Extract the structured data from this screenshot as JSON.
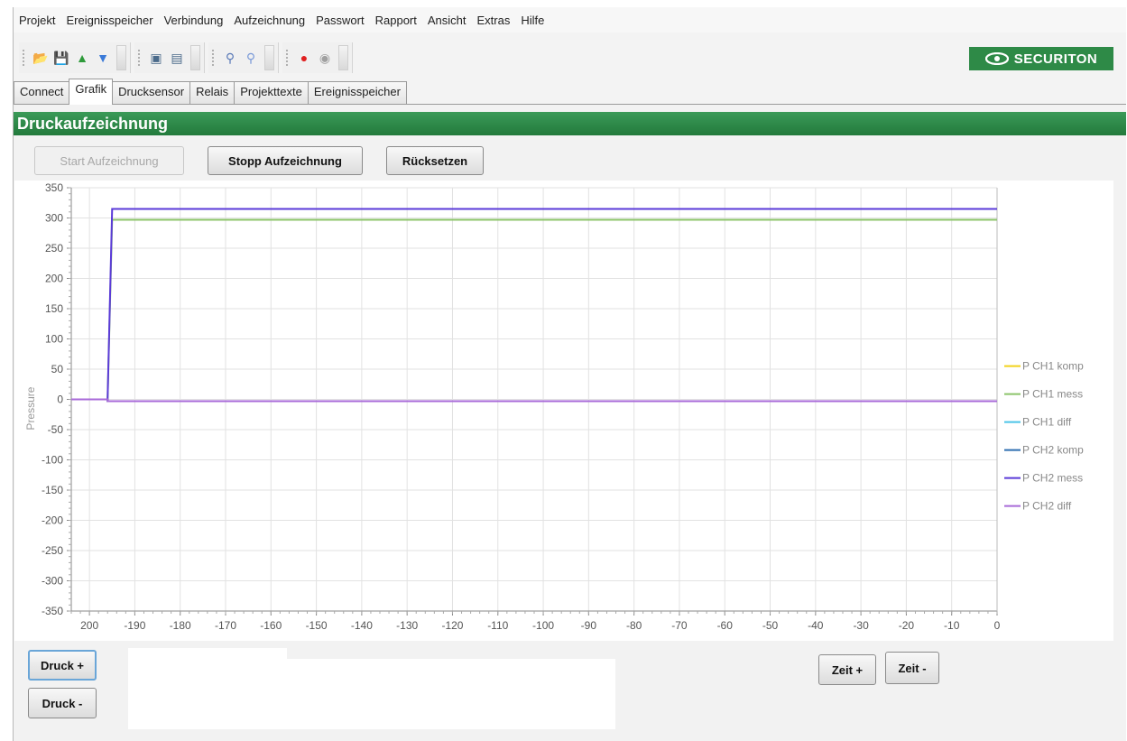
{
  "menu": [
    "Projekt",
    "Ereignisspeicher",
    "Verbindung",
    "Aufzeichnung",
    "Passwort",
    "Rapport",
    "Ansicht",
    "Extras",
    "Hilfe"
  ],
  "brand": {
    "name": "SECURITON",
    "color": "#2e8a47"
  },
  "toolbar": {
    "groups": [
      [
        {
          "icon": "folder-open-icon",
          "glyph": "📂",
          "color": "#d9a21b"
        },
        {
          "icon": "save-icon",
          "glyph": "💾",
          "color": "#7a4a1a"
        },
        {
          "icon": "upload-arrow-icon",
          "glyph": "▲",
          "color": "#2e9a3a"
        },
        {
          "icon": "download-arrow-icon",
          "glyph": "▼",
          "color": "#3a7ad8"
        }
      ],
      [
        {
          "icon": "device-icon",
          "glyph": "▣",
          "color": "#4a6a8a"
        },
        {
          "icon": "device-config-icon",
          "glyph": "▤",
          "color": "#4a6a8a"
        }
      ],
      [
        {
          "icon": "connect-plug-icon",
          "glyph": "⚲",
          "color": "#5a7ab8"
        },
        {
          "icon": "disconnect-plug-icon",
          "glyph": "⚲",
          "color": "#7a9ad8"
        }
      ],
      [
        {
          "icon": "record-icon",
          "glyph": "●",
          "color": "#e02020"
        },
        {
          "icon": "stop-record-icon",
          "glyph": "◉",
          "color": "#a0a0a0"
        }
      ]
    ]
  },
  "tabs": [
    {
      "label": "Connect",
      "active": false
    },
    {
      "label": "Grafik",
      "active": true
    },
    {
      "label": "Drucksensor",
      "active": false
    },
    {
      "label": "Relais",
      "active": false
    },
    {
      "label": "Projekttexte",
      "active": false
    },
    {
      "label": "Ereignisspeicher",
      "active": false
    }
  ],
  "panel": {
    "title": "Druckaufzeichnung",
    "start_label": "Start Aufzeichnung",
    "stop_label": "Stopp Aufzeichnung",
    "reset_label": "Rücksetzen",
    "druck_plus": "Druck +",
    "druck_minus": "Druck -",
    "zeit_plus": "Zeit +",
    "zeit_minus": "Zeit -"
  },
  "chart_data": {
    "type": "line",
    "title": "",
    "xlabel": "",
    "ylabel": "Pressure",
    "xlim": [
      -204,
      0
    ],
    "ylim": [
      -350,
      350
    ],
    "xticks": [
      -200,
      -190,
      -180,
      -170,
      -160,
      -150,
      -140,
      -130,
      -120,
      -110,
      -100,
      -90,
      -80,
      -70,
      -60,
      -50,
      -40,
      -30,
      -20,
      -10,
      0
    ],
    "xtick_labels": [
      "200",
      "-190",
      "-180",
      "-170",
      "-160",
      "-150",
      "-140",
      "-130",
      "-120",
      "-110",
      "-100",
      "-90",
      "-80",
      "-70",
      "-60",
      "-50",
      "-40",
      "-30",
      "-20",
      "-10",
      "0"
    ],
    "yticks": [
      350,
      300,
      250,
      200,
      150,
      100,
      50,
      0,
      -50,
      -100,
      -150,
      -200,
      -250,
      -300,
      -350
    ],
    "grid": true,
    "legend_position": "right",
    "series": [
      {
        "name": "P CH1 komp",
        "color": "#f2d21b",
        "x": [
          -204,
          -196,
          -196,
          0
        ],
        "y": [
          0,
          0,
          -3,
          -3
        ]
      },
      {
        "name": "P CH1 mess",
        "color": "#8cc46a",
        "x": [
          -204,
          -196,
          -195,
          0
        ],
        "y": [
          0,
          0,
          297,
          297
        ]
      },
      {
        "name": "P CH1 diff",
        "color": "#4cc4e8",
        "x": [
          -204,
          -196,
          -196,
          0
        ],
        "y": [
          0,
          0,
          -3,
          -3
        ]
      },
      {
        "name": "P CH2 komp",
        "color": "#2f6fb0",
        "x": [
          -204,
          -196,
          -196,
          0
        ],
        "y": [
          0,
          0,
          -3,
          -3
        ]
      },
      {
        "name": "P CH2 mess",
        "color": "#5a3ad8",
        "x": [
          -204,
          -196,
          -195,
          0
        ],
        "y": [
          0,
          0,
          315,
          315
        ]
      },
      {
        "name": "P CH2 diff",
        "color": "#a86ad8",
        "x": [
          -204,
          -196,
          -196,
          0
        ],
        "y": [
          0,
          0,
          -3,
          -3
        ]
      }
    ]
  }
}
